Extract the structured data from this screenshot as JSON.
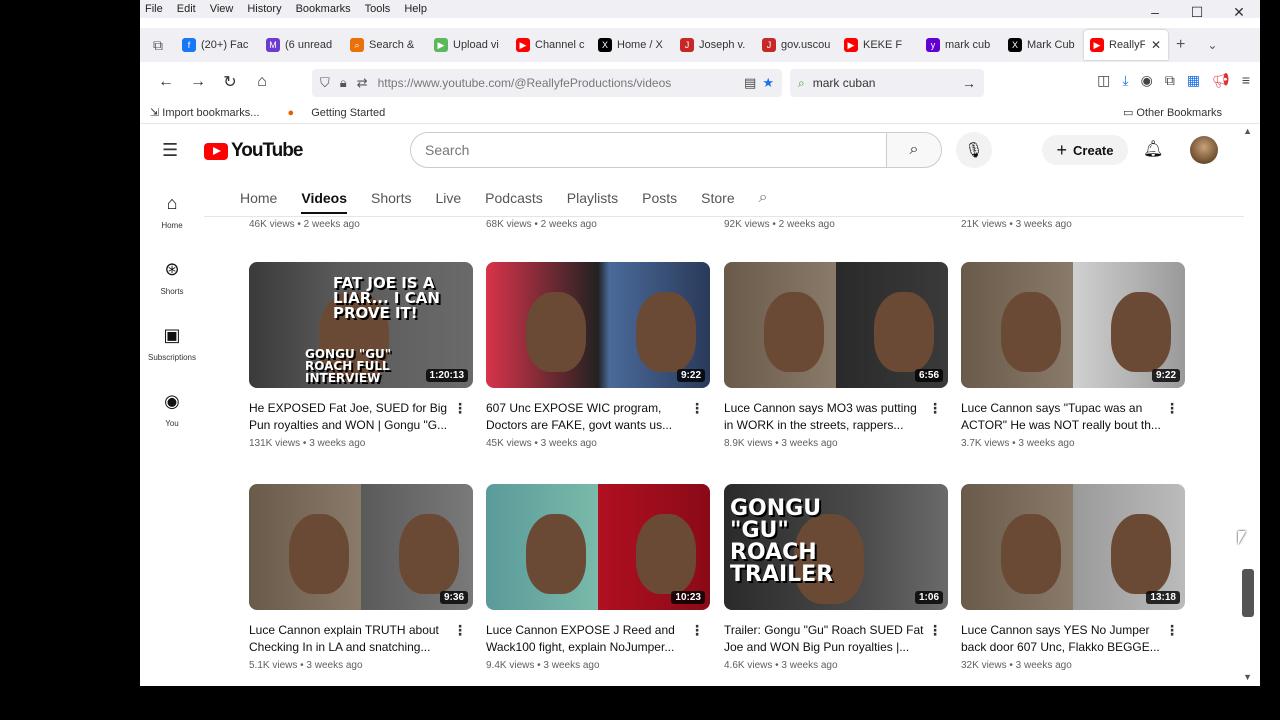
{
  "menubar": {
    "items": [
      "File",
      "Edit",
      "View",
      "History",
      "Bookmarks",
      "Tools",
      "Help"
    ]
  },
  "tabs": [
    {
      "label": "(20+) Fac",
      "color": "#1877f2",
      "glyph": "f"
    },
    {
      "label": "(6 unread",
      "color": "#6e3bd0",
      "glyph": "M"
    },
    {
      "label": "Search &",
      "color": "#e8710a",
      "glyph": "⌕"
    },
    {
      "label": "Upload vi",
      "color": "#5cb85c",
      "glyph": "▶"
    },
    {
      "label": "Channel c",
      "color": "#ff0000",
      "glyph": "▶"
    },
    {
      "label": "Home / X",
      "color": "#000000",
      "glyph": "X"
    },
    {
      "label": "Joseph v.",
      "color": "#c62828",
      "glyph": "J"
    },
    {
      "label": "gov.uscou",
      "color": "#c62828",
      "glyph": "J"
    },
    {
      "label": "KEKE F",
      "color": "#ff0000",
      "glyph": "▶"
    },
    {
      "label": "mark cub",
      "color": "#6001d2",
      "glyph": "y"
    },
    {
      "label": "Mark Cub",
      "color": "#000000",
      "glyph": "X"
    },
    {
      "label": "ReallyF",
      "color": "#ff0000",
      "glyph": "▶"
    }
  ],
  "navbar": {
    "url": "https://www.youtube.com/@ReallyfeProductions/videos",
    "search_value": "mark cuban"
  },
  "bookmarks": {
    "import": "Import bookmarks...",
    "getting_started": "Getting Started",
    "other": "Other Bookmarks"
  },
  "yt": {
    "logo": "YouTube",
    "search_placeholder": "Search",
    "create": "Create",
    "sidebar": [
      {
        "label": "Home",
        "icon": "home-icon",
        "glyph": "⌂"
      },
      {
        "label": "Shorts",
        "icon": "shorts-icon",
        "glyph": "⊛"
      },
      {
        "label": "Subscriptions",
        "icon": "subscriptions-icon",
        "glyph": "▣"
      },
      {
        "label": "You",
        "icon": "you-icon",
        "glyph": "◉"
      }
    ],
    "channel_tabs": [
      "Home",
      "Videos",
      "Shorts",
      "Live",
      "Podcasts",
      "Playlists",
      "Posts",
      "Store"
    ],
    "selected_tab": "Videos",
    "prev_row_meta": [
      "46K views • 2 weeks ago",
      "68K views • 2 weeks ago",
      "92K views • 2 weeks ago",
      "21K views • 3 weeks ago"
    ],
    "videos": [
      {
        "title": "He EXPOSED Fat Joe, SUED for Big Pun royalties and WON | Gongu \"G...",
        "meta": "131K views • 3 weeks ago",
        "duration": "1:20:13",
        "thumb_text_1": "FAT JOE IS A LIAR... I CAN PROVE IT!",
        "thumb_text_2": "GONGU \"GU\" ROACH FULL INTERVIEW"
      },
      {
        "title": "607 Unc EXPOSE WIC program, Doctors are FAKE, govt wants us...",
        "meta": "45K views • 3 weeks ago",
        "duration": "9:22"
      },
      {
        "title": "Luce Cannon says MO3 was putting in WORK in the streets, rappers...",
        "meta": "8.9K views • 3 weeks ago",
        "duration": "6:56"
      },
      {
        "title": "Luce Cannon says \"Tupac was an ACTOR\" He was NOT really bout th...",
        "meta": "3.7K views • 3 weeks ago",
        "duration": "9:22"
      },
      {
        "title": "Luce Cannon explain TRUTH about Checking In in LA and snatching...",
        "meta": "5.1K views • 3 weeks ago",
        "duration": "9:36"
      },
      {
        "title": "Luce Cannon EXPOSE J Reed and Wack100 fight, explain NoJumper...",
        "meta": "9.4K views • 3 weeks ago",
        "duration": "10:23"
      },
      {
        "title": "Trailer: Gongu \"Gu\" Roach SUED Fat Joe and WON Big Pun royalties |...",
        "meta": "4.6K views • 3 weeks ago",
        "duration": "1:06",
        "thumb_text_1": "GONGU \"GU\" ROACH TRAILER"
      },
      {
        "title": "Luce Cannon says YES No Jumper back door 607 Unc, Flakko BEGGE...",
        "meta": "32K views • 3 weeks ago",
        "duration": "13:18"
      }
    ]
  }
}
